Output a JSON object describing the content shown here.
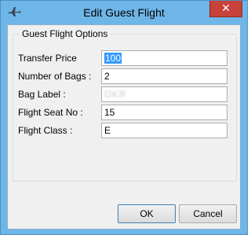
{
  "window": {
    "title": "Edit Guest Flight",
    "close_glyph": "✕"
  },
  "group": {
    "title": "Guest Flight Options"
  },
  "fields": {
    "transfer_price": {
      "label": "Transfer Price",
      "value": "100"
    },
    "number_of_bags": {
      "label": "Number of Bags :",
      "value": "2"
    },
    "bag_label": {
      "label": "Bag Label :",
      "value": "DKR"
    },
    "flight_seat_no": {
      "label": "Flight Seat No :",
      "value": "15"
    },
    "flight_class": {
      "label": "Flight Class :",
      "value": "E"
    }
  },
  "buttons": {
    "ok": "OK",
    "cancel": "Cancel"
  },
  "icons": {
    "app": "airplane-icon",
    "close": "close-icon"
  },
  "colors": {
    "frame": "#6fb6e8",
    "close": "#c7423a",
    "selection": "#3399ff"
  }
}
